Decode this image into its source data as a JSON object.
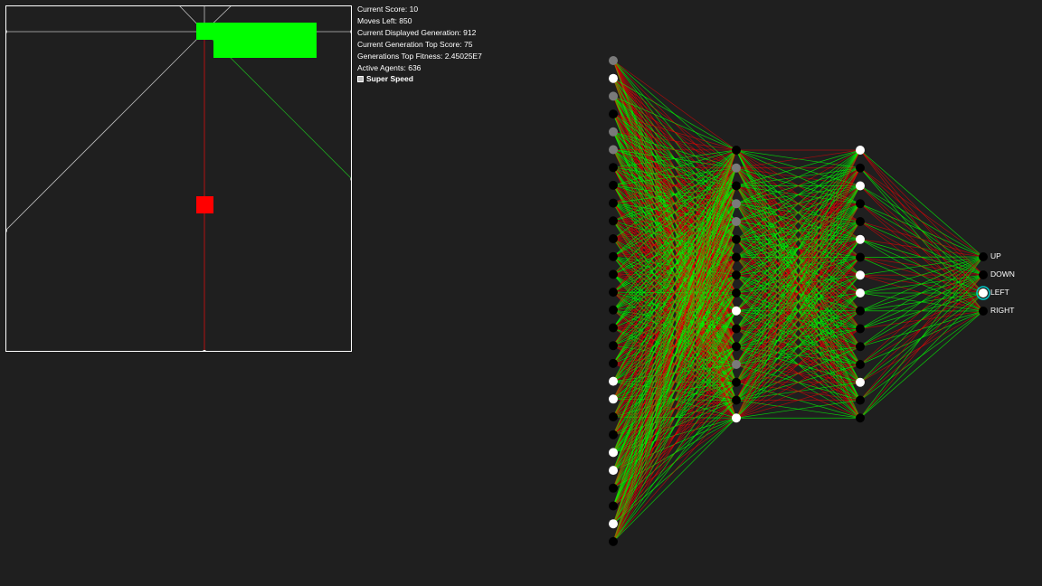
{
  "stats": {
    "current_score": "Current Score: 10",
    "moves_left": "Moves Left: 850",
    "displayed_generation": "Current Displayed Generation: 912",
    "generation_top_score": "Current Generation Top Score: 75",
    "generations_top_fitness": "Generations Top Fitness: 2.45025E7",
    "active_agents": "Active Agents: 636",
    "super_speed_label": "Super Speed"
  },
  "network": {
    "output_labels": [
      "UP",
      "DOWN",
      "LEFT",
      "RIGHT"
    ],
    "active_output": "LEFT",
    "layer_sizes": [
      27,
      16,
      16,
      4
    ],
    "input_node_states": [
      "gray",
      "white",
      "gray",
      "black",
      "gray",
      "gray",
      "black",
      "black",
      "black",
      "black",
      "black",
      "black",
      "black",
      "black",
      "black",
      "black",
      "black",
      "black",
      "white",
      "white",
      "black",
      "black",
      "white",
      "white",
      "black",
      "black",
      "white",
      "black"
    ],
    "hidden1_node_states": [
      "black",
      "gray",
      "black",
      "gray",
      "gray",
      "black",
      "black",
      "black",
      "black",
      "white",
      "black",
      "black",
      "gray",
      "black",
      "black",
      "white"
    ],
    "hidden2_node_states": [
      "white",
      "black",
      "white",
      "black",
      "black",
      "white",
      "black",
      "white",
      "white",
      "black",
      "black",
      "black",
      "black",
      "white",
      "black",
      "black"
    ],
    "output_node_states": [
      "black",
      "black",
      "white",
      "black"
    ]
  },
  "colors": {
    "background": "#1f1f1f",
    "snake": "#00ff00",
    "food": "#ff0000",
    "border": "#ffffff",
    "positive_weight": "#00ff00",
    "negative_weight": "#ff0000",
    "active_output_ring": "#00c8c8"
  }
}
